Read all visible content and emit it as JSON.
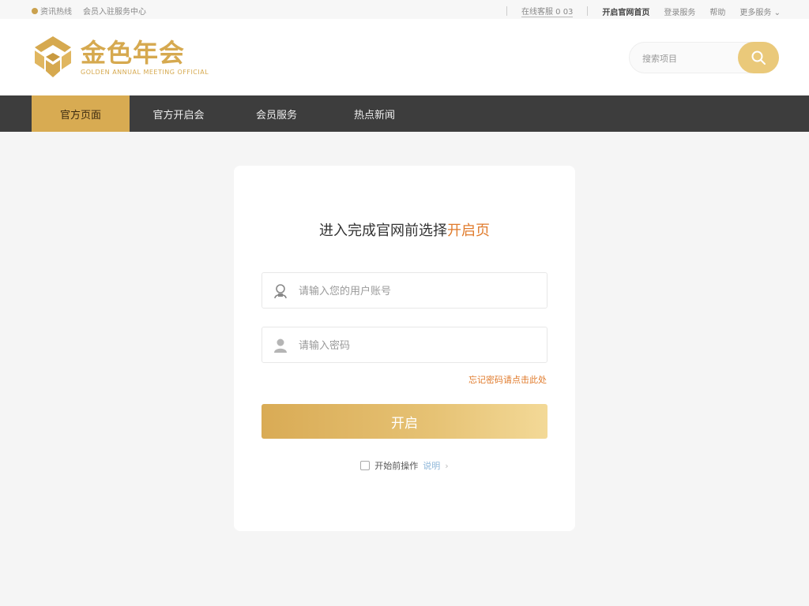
{
  "topbar": {
    "left_items": [
      "资讯热线",
      "会员入驻服务中心"
    ],
    "right_items": [
      "在线客服 0 03",
      "开启官网首页",
      "登录服务",
      "帮助",
      "更多服务"
    ]
  },
  "header": {
    "logo_title": "金色年会",
    "logo_subtitle": "GOLDEN ANNUAL MEETING OFFICIAL",
    "search_placeholder": "搜索项目"
  },
  "nav": {
    "items": [
      "官方页面",
      "官方开启会",
      "会员服务",
      "热点新闻"
    ]
  },
  "login": {
    "title_prefix": "进入完成官网前选择",
    "title_accent": "开启页",
    "username_placeholder": "请输入您的用户账号",
    "password_placeholder": "请输入密码",
    "forgot": "忘记密码请点击此处",
    "submit": "开启",
    "agree_text": "开始前操作",
    "agree_link": "说明"
  },
  "colors": {
    "accent_gold": "#d8ab52",
    "accent_orange": "#e07b2c",
    "nav_bg": "#3d3d3d"
  }
}
